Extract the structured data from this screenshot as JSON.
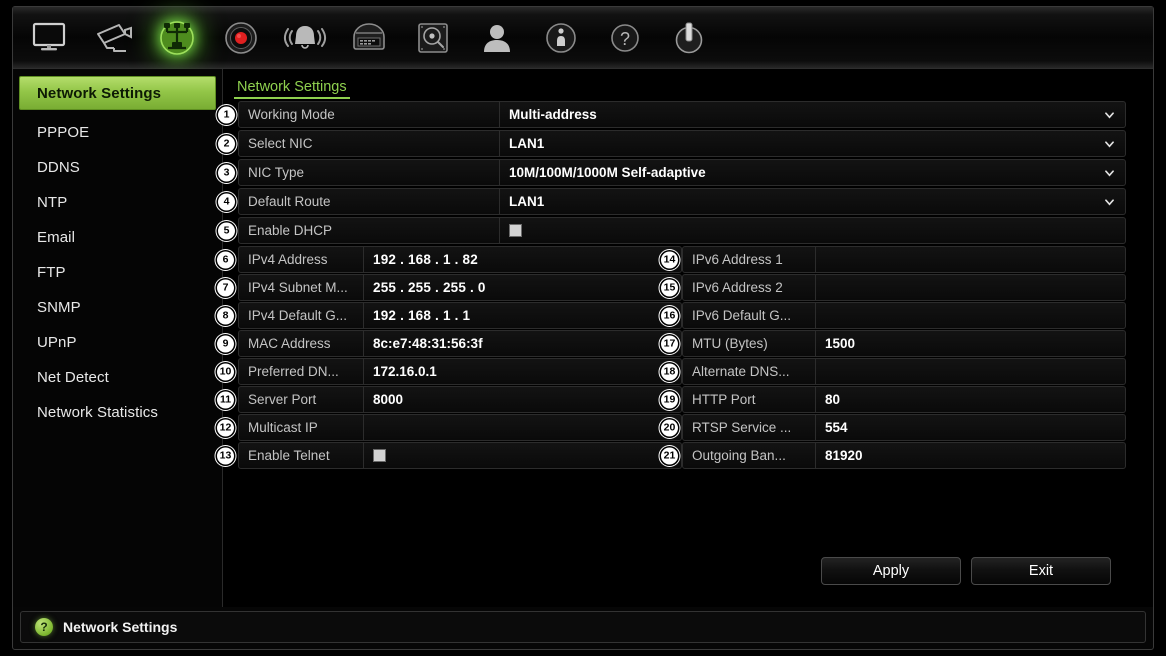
{
  "window": {
    "title": "Network Settings"
  },
  "toolbar": {
    "items": [
      {
        "icon": "monitor-icon",
        "name": "display",
        "active": false
      },
      {
        "icon": "camera-icon",
        "name": "camera",
        "active": false
      },
      {
        "icon": "network-icon",
        "name": "network",
        "active": true
      },
      {
        "icon": "record-icon",
        "name": "record",
        "active": false
      },
      {
        "icon": "alarm-icon",
        "name": "alarm",
        "active": false
      },
      {
        "icon": "device-icon",
        "name": "device",
        "active": false
      },
      {
        "icon": "hdd-icon",
        "name": "storage",
        "active": false
      },
      {
        "icon": "user-icon",
        "name": "user",
        "active": false
      },
      {
        "icon": "info-icon",
        "name": "info",
        "active": false
      },
      {
        "icon": "help-icon",
        "name": "help",
        "active": false
      },
      {
        "icon": "power-icon",
        "name": "shutdown",
        "active": false
      }
    ]
  },
  "sidebar": {
    "items": [
      {
        "label": "Network Settings",
        "active": true
      },
      {
        "label": "PPPOE",
        "active": false
      },
      {
        "label": "DDNS",
        "active": false
      },
      {
        "label": "NTP",
        "active": false
      },
      {
        "label": "Email",
        "active": false
      },
      {
        "label": "FTP",
        "active": false
      },
      {
        "label": "SNMP",
        "active": false
      },
      {
        "label": "UPnP",
        "active": false
      },
      {
        "label": "Net Detect",
        "active": false
      },
      {
        "label": "Network Statistics",
        "active": false
      }
    ]
  },
  "tab": {
    "label": "Network Settings"
  },
  "form": {
    "wide_rows": [
      {
        "num": "1",
        "label": "Working Mode",
        "value": "Multi-address",
        "control": "dropdown"
      },
      {
        "num": "2",
        "label": "Select NIC",
        "value": "LAN1",
        "control": "dropdown"
      },
      {
        "num": "3",
        "label": "NIC Type",
        "value": "10M/100M/1000M Self-adaptive",
        "control": "dropdown"
      },
      {
        "num": "4",
        "label": "Default Route",
        "value": "LAN1",
        "control": "dropdown"
      },
      {
        "num": "5",
        "label": "Enable DHCP",
        "value": "",
        "control": "checkbox",
        "checked": false
      }
    ],
    "split_rows": [
      {
        "left": {
          "num": "6",
          "label": "IPv4 Address",
          "value": "192 . 168 . 1      . 82",
          "control": "text"
        },
        "right": {
          "num": "14",
          "label": "IPv6 Address 1",
          "value": "",
          "control": "text"
        }
      },
      {
        "left": {
          "num": "7",
          "label": "IPv4 Subnet M...",
          "value": "255 . 255 . 255 . 0",
          "control": "text"
        },
        "right": {
          "num": "15",
          "label": "IPv6 Address 2",
          "value": "",
          "control": "text"
        }
      },
      {
        "left": {
          "num": "8",
          "label": "IPv4 Default G...",
          "value": "192 . 168 . 1      . 1",
          "control": "text"
        },
        "right": {
          "num": "16",
          "label": "IPv6 Default G...",
          "value": "",
          "control": "text"
        }
      },
      {
        "left": {
          "num": "9",
          "label": "MAC Address",
          "value": "8c:e7:48:31:56:3f",
          "control": "readonly"
        },
        "right": {
          "num": "17",
          "label": "MTU (Bytes)",
          "value": "1500",
          "control": "text"
        }
      },
      {
        "left": {
          "num": "10",
          "label": "Preferred DN...",
          "value": "172.16.0.1",
          "control": "text"
        },
        "right": {
          "num": "18",
          "label": "Alternate DNS...",
          "value": "",
          "control": "text"
        }
      },
      {
        "left": {
          "num": "11",
          "label": "Server Port",
          "value": "8000",
          "control": "text"
        },
        "right": {
          "num": "19",
          "label": "HTTP Port",
          "value": "80",
          "control": "text"
        }
      },
      {
        "left": {
          "num": "12",
          "label": "Multicast IP",
          "value": "",
          "control": "text"
        },
        "right": {
          "num": "20",
          "label": "RTSP Service ...",
          "value": "554",
          "control": "text"
        }
      },
      {
        "left": {
          "num": "13",
          "label": "Enable Telnet",
          "value": "",
          "control": "checkbox",
          "checked": false
        },
        "right": {
          "num": "21",
          "label": "Outgoing Ban...",
          "value": "81920",
          "control": "text"
        }
      }
    ]
  },
  "buttons": {
    "apply": "Apply",
    "exit": "Exit"
  },
  "status": {
    "icon": "?",
    "text": "Network Settings"
  },
  "colors": {
    "accent_green": "#8fd14f",
    "sidebar_active_green": "#93c648",
    "record_red": "#e02020",
    "background": "#000000",
    "field_bg": "#0d0d0d",
    "border": "#2c2c2c"
  }
}
